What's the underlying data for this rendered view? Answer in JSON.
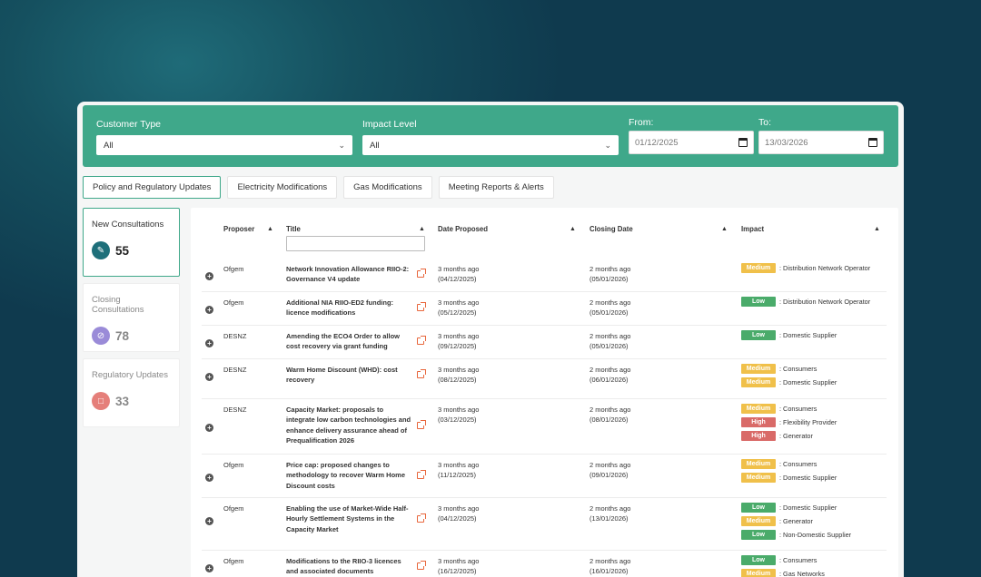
{
  "filters": {
    "customer_type": {
      "label": "Customer Type",
      "value": "All"
    },
    "impact_level": {
      "label": "Impact Level",
      "value": "All"
    },
    "from": {
      "label": "From:",
      "value": "01/12/2025"
    },
    "to": {
      "label": "To:",
      "value": "13/03/2026"
    }
  },
  "tabs": [
    {
      "label": "Policy and Regulatory Updates"
    },
    {
      "label": "Electricity Modifications"
    },
    {
      "label": "Gas Modifications"
    },
    {
      "label": "Meeting Reports & Alerts"
    }
  ],
  "cards": [
    {
      "title": "New Consultations",
      "count": "55",
      "color": "#1e6f7a",
      "icon": "document-icon"
    },
    {
      "title": "Closing Consultations",
      "count": "78",
      "color": "#9a8bd8",
      "icon": "clock-icon"
    },
    {
      "title": "Regulatory Updates",
      "count": "33",
      "color": "#e57f7a",
      "icon": "message-icon"
    }
  ],
  "table": {
    "headers": {
      "proposer": "Proposer",
      "title": "Title",
      "date_proposed": "Date Proposed",
      "closing_date": "Closing Date",
      "impact": "Impact"
    },
    "rows": [
      {
        "proposer": "Ofgem",
        "title": "Network Innovation Allowance RIIO-2: Governance V4 update",
        "proposed_rel": "3 months ago",
        "proposed_date": "(04/12/2025)",
        "closing_rel": "2 months ago",
        "closing_date": "(05/01/2026)",
        "impacts": [
          {
            "level": "Medium",
            "group": ": Distribution Network Operator"
          }
        ]
      },
      {
        "proposer": "Ofgem",
        "title": "Additional NIA RIIO-ED2 funding: licence modifications",
        "proposed_rel": "3 months ago",
        "proposed_date": "(05/12/2025)",
        "closing_rel": "2 months ago",
        "closing_date": "(05/01/2026)",
        "impacts": [
          {
            "level": "Low",
            "group": ": Distribution Network Operator"
          }
        ]
      },
      {
        "proposer": "DESNZ",
        "title": "Amending the ECO4 Order to allow cost recovery via grant funding",
        "proposed_rel": "3 months ago",
        "proposed_date": "(09/12/2025)",
        "closing_rel": "2 months ago",
        "closing_date": "(05/01/2026)",
        "impacts": [
          {
            "level": "Low",
            "group": ": Domestic Supplier"
          }
        ]
      },
      {
        "proposer": "DESNZ",
        "title": "Warm Home Discount (WHD): cost recovery",
        "proposed_rel": "3 months ago",
        "proposed_date": "(08/12/2025)",
        "closing_rel": "2 months ago",
        "closing_date": "(06/01/2026)",
        "impacts": [
          {
            "level": "Medium",
            "group": ": Consumers"
          },
          {
            "level": "Medium",
            "group": ": Domestic Supplier"
          }
        ]
      },
      {
        "proposer": "DESNZ",
        "title": "Capacity Market: proposals to integrate low carbon technologies and enhance delivery assurance ahead of Prequalification 2026",
        "proposed_rel": "3 months ago",
        "proposed_date": "(03/12/2025)",
        "closing_rel": "2 months ago",
        "closing_date": "(08/01/2026)",
        "impacts": [
          {
            "level": "Medium",
            "group": ": Consumers"
          },
          {
            "level": "High",
            "group": ": Flexibility Provider"
          },
          {
            "level": "High",
            "group": ": Generator"
          }
        ]
      },
      {
        "proposer": "Ofgem",
        "title": "Price cap: proposed changes to methodology to recover Warm Home Discount costs",
        "proposed_rel": "3 months ago",
        "proposed_date": "(11/12/2025)",
        "closing_rel": "2 months ago",
        "closing_date": "(09/01/2026)",
        "impacts": [
          {
            "level": "Medium",
            "group": ": Consumers"
          },
          {
            "level": "Medium",
            "group": ": Domestic Supplier"
          }
        ]
      },
      {
        "proposer": "Ofgem",
        "title": "Enabling the use of Market-Wide Half-Hourly Settlement Systems in the Capacity Market",
        "proposed_rel": "3 months ago",
        "proposed_date": "(04/12/2025)",
        "closing_rel": "2 months ago",
        "closing_date": "(13/01/2026)",
        "impacts": [
          {
            "level": "Low",
            "group": ": Domestic Supplier"
          },
          {
            "level": "Medium",
            "group": ": Generator"
          },
          {
            "level": "Low",
            "group": ": Non-Domestic Supplier"
          }
        ]
      },
      {
        "proposer": "Ofgem",
        "title": "Modifications to the RIIO-3 licences and associated documents",
        "proposed_rel": "3 months ago",
        "proposed_date": "(16/12/2025)",
        "closing_rel": "2 months ago",
        "closing_date": "(16/01/2026)",
        "impacts": [
          {
            "level": "Low",
            "group": ": Consumers"
          },
          {
            "level": "Medium",
            "group": ": Gas Networks"
          }
        ]
      }
    ]
  }
}
